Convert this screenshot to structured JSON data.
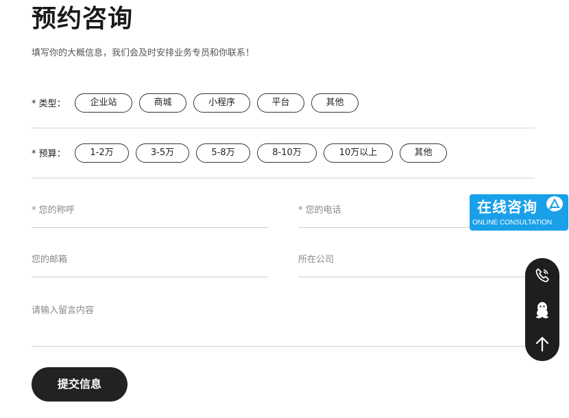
{
  "header": {
    "title": "预约咨询",
    "description": "填写你的大概信息，我们会及时安排业务专员和你联系！"
  },
  "type_row": {
    "label": "* 类型：",
    "options": [
      "企业站",
      "商城",
      "小程序",
      "平台",
      "其他"
    ]
  },
  "budget_row": {
    "label": "* 预算：",
    "options": [
      "1-2万",
      "3-5万",
      "5-8万",
      "8-10万",
      "10万以上",
      "其他"
    ]
  },
  "form": {
    "name_placeholder": "* 您的称呼",
    "phone_placeholder": "* 您的电话",
    "email_placeholder": "您的邮箱",
    "company_placeholder": "所在公司",
    "message_placeholder": "请输入留言内容",
    "submit_label": "提交信息"
  },
  "online_badge": {
    "title": "在线咨询",
    "subtitle": "ONLINE CONSULTATION",
    "icon": "chat-bubble-icon"
  },
  "side_toolbar": {
    "icons": [
      "phone-icon",
      "qq-penguin-icon",
      "arrow-up-icon"
    ]
  },
  "colors": {
    "accent": "#1aa0e8",
    "dark": "#222222",
    "divider": "#d4d4d4"
  }
}
